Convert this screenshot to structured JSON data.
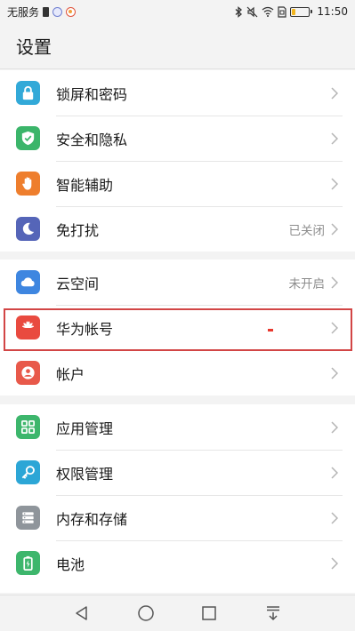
{
  "status_bar": {
    "carrier": "无服务",
    "time": "11:50",
    "battery_level": 0.2
  },
  "header": {
    "title": "设置"
  },
  "groups": [
    {
      "items": [
        {
          "label": "锁屏和密码",
          "icon": "lock-icon",
          "color": "#32a9d8"
        },
        {
          "label": "安全和隐私",
          "icon": "shield-icon",
          "color": "#3bb56a"
        },
        {
          "label": "智能辅助",
          "icon": "hand-icon",
          "color": "#ee7e2d"
        },
        {
          "label": "免打扰",
          "icon": "moon-icon",
          "color": "#5565b8",
          "value": "已关闭"
        }
      ]
    },
    {
      "items": [
        {
          "label": "云空间",
          "icon": "cloud-icon",
          "color": "#3e86e0",
          "value": "未开启"
        },
        {
          "label": "华为帐号",
          "icon": "huawei-logo-icon",
          "color": "#e94a3f"
        },
        {
          "label": "帐户",
          "icon": "account-icon",
          "color": "#e8594a"
        }
      ]
    },
    {
      "items": [
        {
          "label": "应用管理",
          "icon": "apps-icon",
          "color": "#3db66c"
        },
        {
          "label": "权限管理",
          "icon": "key-icon",
          "color": "#2ca6d6"
        },
        {
          "label": "内存和存储",
          "icon": "storage-icon",
          "color": "#8f959b"
        },
        {
          "label": "电池",
          "icon": "battery-icon",
          "color": "#3db66c"
        }
      ]
    }
  ]
}
